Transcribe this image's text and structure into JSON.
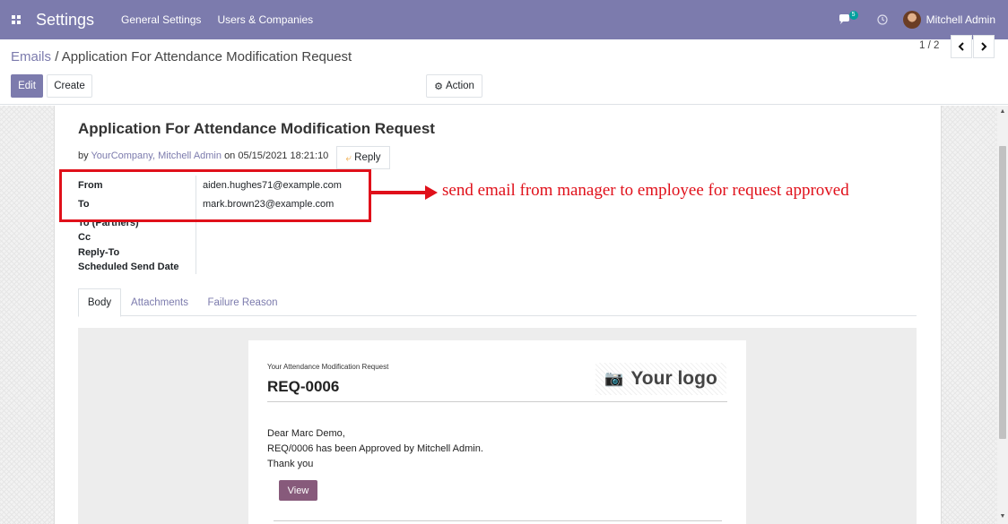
{
  "navbar": {
    "app_title": "Settings",
    "menu": [
      "General Settings",
      "Users & Companies"
    ],
    "chat_count": "5",
    "user_name": "Mitchell Admin"
  },
  "control_panel": {
    "breadcrumb_parent": "Emails",
    "breadcrumb_separator": "/",
    "breadcrumb_current": "Application For Attendance Modification Request",
    "edit_label": "Edit",
    "create_label": "Create",
    "action_label": "Action",
    "pager": "1 / 2"
  },
  "mail": {
    "subject": "Application For Attendance Modification Request",
    "by_prefix": "by",
    "author": "YourCompany, Mitchell Admin",
    "on_prefix": "on",
    "date": "05/15/2021 18:21:10",
    "reply_label": "Reply",
    "fields": [
      {
        "label": "From",
        "value": "aiden.hughes71@example.com"
      },
      {
        "label": "To",
        "value": "mark.brown23@example.com"
      },
      {
        "label": "To (Partners)",
        "value": ""
      },
      {
        "label": "Cc",
        "value": ""
      },
      {
        "label": "Reply-To",
        "value": ""
      },
      {
        "label": "Scheduled Send Date",
        "value": ""
      }
    ],
    "tabs": [
      "Body",
      "Attachments",
      "Failure Reason"
    ],
    "active_tab": "Body"
  },
  "annotation": {
    "text": "send email from manager to employee for request approved",
    "color": "#e0101a"
  },
  "email_body": {
    "subtitle": "Your Attendance Modification Request",
    "reference": "REQ-0006",
    "logo_text": "Your logo",
    "greeting": "Dear Marc Demo,",
    "message": "REQ/0006 has been Approved by Mitchell Admin.",
    "closing": "Thank you",
    "view_label": "View"
  },
  "colors": {
    "brand": "#7c7bad",
    "view_button": "#875a7b"
  }
}
